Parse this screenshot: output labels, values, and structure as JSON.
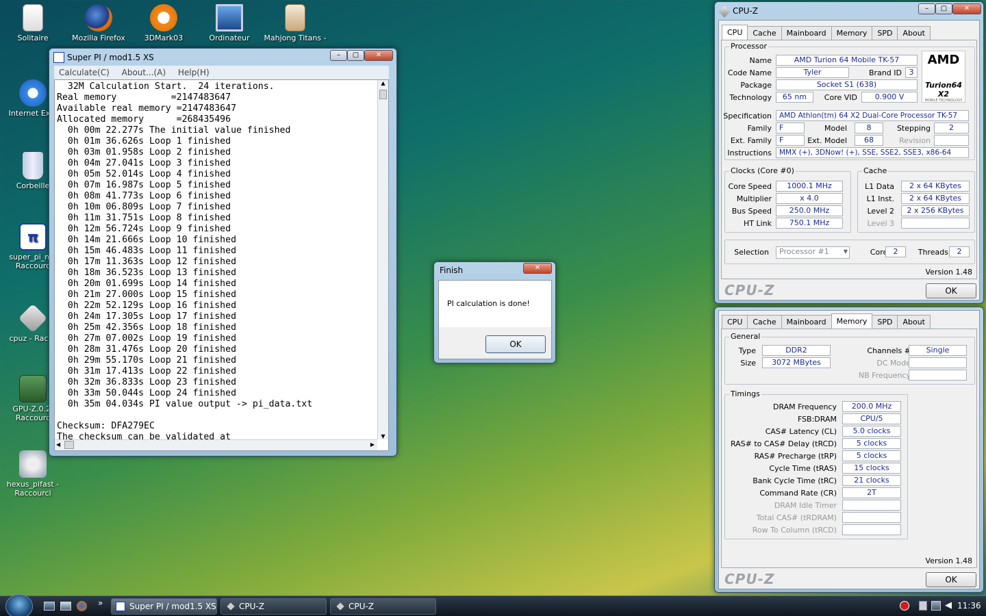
{
  "desktop": {
    "icons": [
      {
        "label": "Solitaire",
        "icon": "solitaire-icon"
      },
      {
        "label": "Mozilla Firefox",
        "icon": "firefox-icon"
      },
      {
        "label": "3DMark03",
        "icon": "3dmark-icon"
      },
      {
        "label": "Ordinateur",
        "icon": "computer-icon"
      },
      {
        "label": "Mahjong Titans -",
        "icon": "mahjong-icon"
      },
      {
        "label": "Internet Expl",
        "icon": "ie-icon"
      },
      {
        "label": "Corbeille",
        "icon": "recycle-bin-icon"
      },
      {
        "label": "super_pi_mo Raccourc",
        "icon": "superpi-icon"
      },
      {
        "label": "cpuz - Raccc",
        "icon": "cpuz-icon"
      },
      {
        "label": "GPU-Z.0.2. Raccourc",
        "icon": "gpuz-icon"
      },
      {
        "label": "hexus_pifast - Raccourci",
        "icon": "hexus-icon"
      }
    ]
  },
  "superpi": {
    "title": "Super PI / mod1.5 XS",
    "menu": [
      "Calculate(C)",
      "About...(A)",
      "Help(H)"
    ],
    "lines": [
      "  32M Calculation Start.  24 iterations.",
      "Real memory          =2147483647",
      "Available real memory =2147483647",
      "Allocated memory      =268435496",
      "  0h 00m 22.277s The initial value finished",
      "  0h 01m 36.626s Loop 1 finished",
      "  0h 03m 01.958s Loop 2 finished",
      "  0h 04m 27.041s Loop 3 finished",
      "  0h 05m 52.014s Loop 4 finished",
      "  0h 07m 16.987s Loop 5 finished",
      "  0h 08m 41.773s Loop 6 finished",
      "  0h 10m 06.809s Loop 7 finished",
      "  0h 11m 31.751s Loop 8 finished",
      "  0h 12m 56.724s Loop 9 finished",
      "  0h 14m 21.666s Loop 10 finished",
      "  0h 15m 46.483s Loop 11 finished",
      "  0h 17m 11.363s Loop 12 finished",
      "  0h 18m 36.523s Loop 13 finished",
      "  0h 20m 01.699s Loop 14 finished",
      "  0h 21m 27.000s Loop 15 finished",
      "  0h 22m 52.129s Loop 16 finished",
      "  0h 24m 17.305s Loop 17 finished",
      "  0h 25m 42.356s Loop 18 finished",
      "  0h 27m 07.002s Loop 19 finished",
      "  0h 28m 31.476s Loop 20 finished",
      "  0h 29m 55.170s Loop 21 finished",
      "  0h 31m 17.413s Loop 22 finished",
      "  0h 32m 36.833s Loop 23 finished",
      "  0h 33m 50.044s Loop 24 finished",
      "  0h 35m 04.034s PI value output -> pi_data.txt",
      "",
      "Checksum: DFA279EC",
      "The checksum can be validated at"
    ]
  },
  "dialog": {
    "title": "Finish",
    "message": "PI calculation is done!",
    "ok": "OK"
  },
  "cpuz_top": {
    "title": "CPU-Z",
    "tabs": [
      "CPU",
      "Cache",
      "Mainboard",
      "Memory",
      "SPD",
      "About"
    ],
    "processor_title": "Processor",
    "name_l": "Name",
    "name": "AMD Turion 64 Mobile TK-57",
    "codename_l": "Code Name",
    "codename": "Tyler",
    "brandid_l": "Brand ID",
    "brandid": "3",
    "package_l": "Package",
    "package": "Socket S1 (638)",
    "tech_l": "Technology",
    "tech": "65 nm",
    "vid_l": "Core VID",
    "vid": "0.900 V",
    "spec_l": "Specification",
    "spec": "AMD Athlon(tm) 64 X2 Dual-Core Processor TK-57",
    "family_l": "Family",
    "family": "F",
    "model_l": "Model",
    "model": "8",
    "stepping_l": "Stepping",
    "stepping": "2",
    "extfam_l": "Ext. Family",
    "extfam": "F",
    "extmodel_l": "Ext. Model",
    "extmodel": "68",
    "revision_l": "Revision",
    "revision": "",
    "instr_l": "Instructions",
    "instr": "MMX (+), 3DNow! (+), SSE, SSE2, SSE3, x86-64",
    "logo_top": "AMD",
    "logo_bottom": "Turion64 X2",
    "logo_sub": "MOBILE TECHNOLOGY",
    "clocks_title": "Clocks (Core #0)",
    "corespeed_l": "Core Speed",
    "corespeed": "1000.1 MHz",
    "mult_l": "Multiplier",
    "mult": "x 4.0",
    "bus_l": "Bus Speed",
    "bus": "250.0 MHz",
    "ht_l": "HT Link",
    "ht": "750.1 MHz",
    "cache_title": "Cache",
    "l1d_l": "L1 Data",
    "l1d": "2 x 64 KBytes",
    "l1i_l": "L1 Inst.",
    "l1i": "2 x 64 KBytes",
    "l2_l": "Level 2",
    "l2": "2 x 256 KBytes",
    "l3_l": "Level 3",
    "l3": "",
    "selection_l": "Selection",
    "selection": "Processor #1",
    "cores_l": "Cores",
    "cores": "2",
    "threads_l": "Threads",
    "threads": "2",
    "version": "Version 1.48",
    "brand": "CPU-Z",
    "ok": "OK"
  },
  "cpuz_bottom": {
    "tabs": [
      "CPU",
      "Cache",
      "Mainboard",
      "Memory",
      "SPD",
      "About"
    ],
    "general_title": "General",
    "type_l": "Type",
    "type": "DDR2",
    "size_l": "Size",
    "size": "3072 MBytes",
    "channels_l": "Channels #",
    "channels": "Single",
    "dcmode_l": "DC Mode",
    "dcmode": "",
    "nbfreq_l": "NB Frequency",
    "nbfreq": "",
    "timings_title": "Timings",
    "timings": [
      {
        "label": "DRAM Frequency",
        "value": "200.0 MHz",
        "dim": false
      },
      {
        "label": "FSB:DRAM",
        "value": "CPU/5",
        "dim": false
      },
      {
        "label": "CAS# Latency (CL)",
        "value": "5.0 clocks",
        "dim": false
      },
      {
        "label": "RAS# to CAS# Delay (tRCD)",
        "value": "5 clocks",
        "dim": false
      },
      {
        "label": "RAS# Precharge (tRP)",
        "value": "5 clocks",
        "dim": false
      },
      {
        "label": "Cycle Time (tRAS)",
        "value": "15 clocks",
        "dim": false
      },
      {
        "label": "Bank Cycle Time (tRC)",
        "value": "21 clocks",
        "dim": false
      },
      {
        "label": "Command Rate (CR)",
        "value": "2T",
        "dim": false
      },
      {
        "label": "DRAM Idle Timer",
        "value": "",
        "dim": true
      },
      {
        "label": "Total CAS# (tRDRAM)",
        "value": "",
        "dim": true
      },
      {
        "label": "Row To Column (tRCD)",
        "value": "",
        "dim": true
      }
    ],
    "version": "Version 1.48",
    "brand": "CPU-Z",
    "ok": "OK"
  },
  "taskbar": {
    "tasks": [
      "Super PI / mod1.5 XS",
      "CPU-Z",
      "CPU-Z"
    ],
    "clock": "11:36",
    "more": "»"
  }
}
